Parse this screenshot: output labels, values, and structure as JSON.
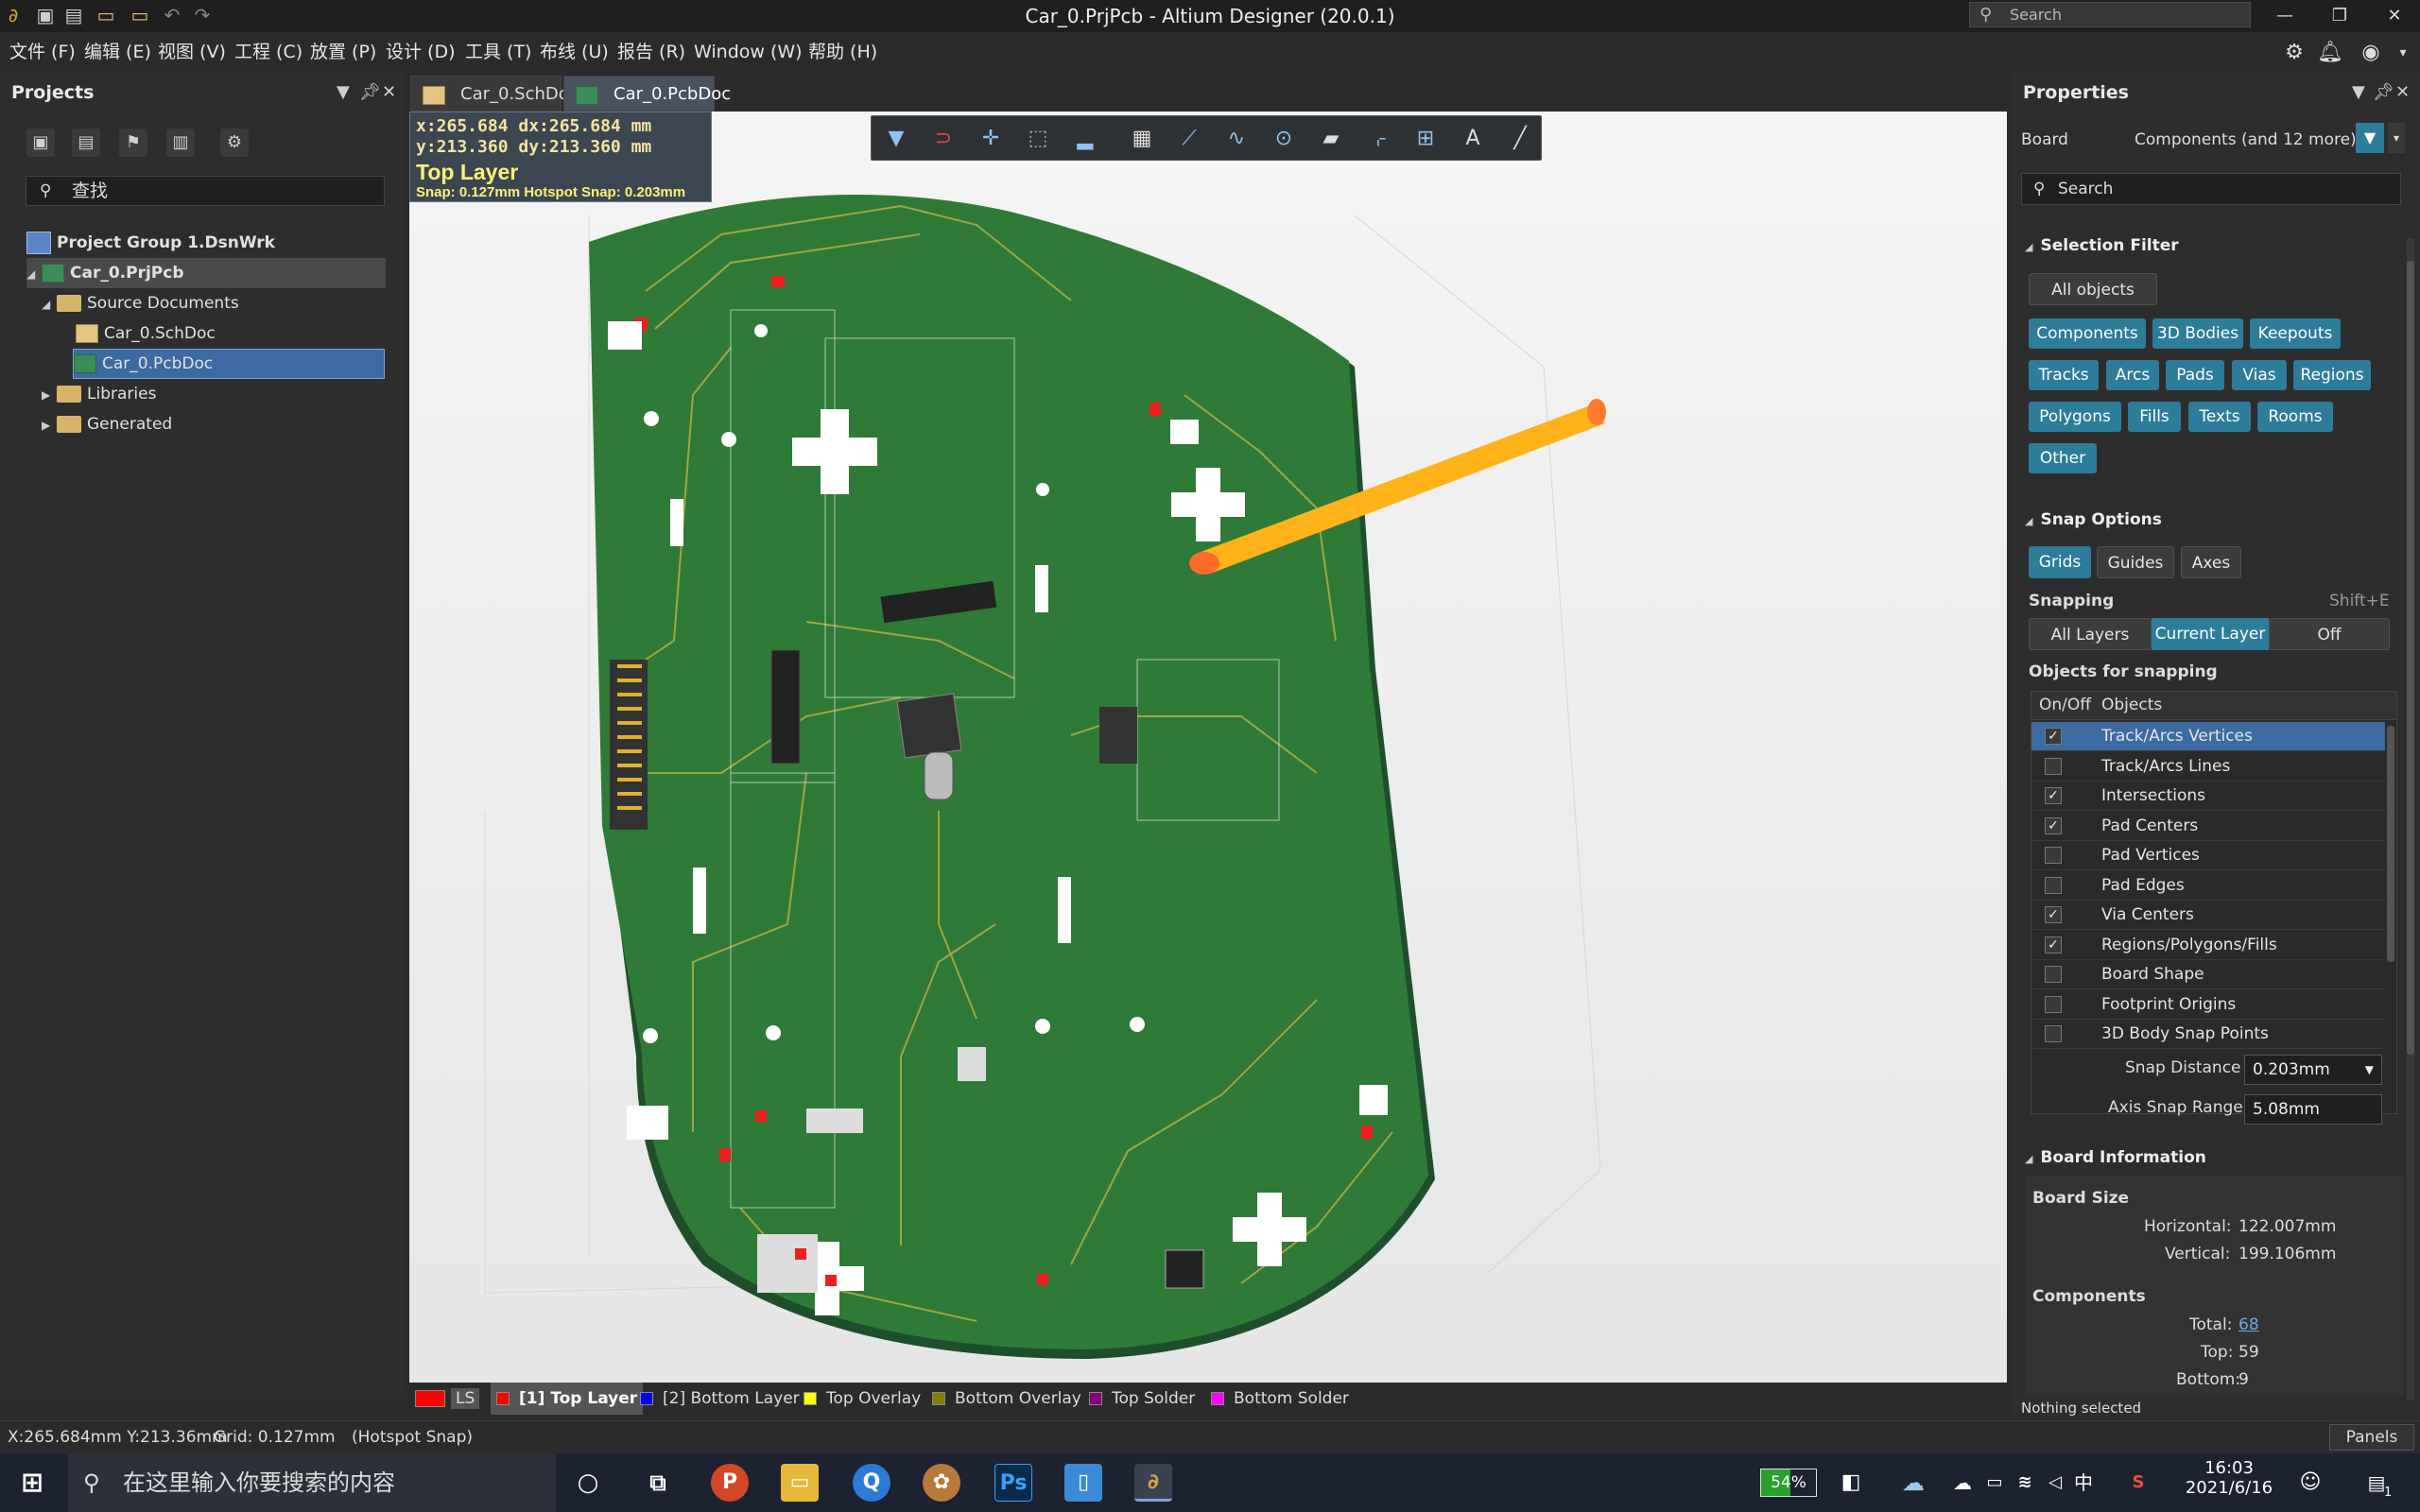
{
  "window": {
    "title": "Car_0.PrjPcb - Altium Designer (20.0.1)",
    "search_placeholder": "Search"
  },
  "menu": [
    "文件 (F)",
    "编辑 (E)",
    "视图 (V)",
    "工程 (C)",
    "放置 (P)",
    "设计 (D)",
    "工具 (T)",
    "布线 (U)",
    "报告 (R)",
    "Window (W)",
    "帮助 (H)"
  ],
  "projects_panel": {
    "title": "Projects",
    "search_placeholder": "查找",
    "tree": {
      "group": "Project Group 1.DsnWrk",
      "project": "Car_0.PrjPcb",
      "source_folder": "Source Documents",
      "sch_doc": "Car_0.SchDoc",
      "pcb_doc": "Car_0.PcbDoc",
      "libraries": "Libraries",
      "generated": "Generated"
    }
  },
  "tabs": [
    "Car_0.SchDoc",
    "Car_0.PcbDoc"
  ],
  "coords": {
    "line1": "x:265.684   dx:265.684 mm",
    "line2": "y:213.360   dy:213.360 mm",
    "layer": "Top Layer",
    "snap": "Snap: 0.127mm Hotspot Snap: 0.203mm"
  },
  "layer_tabs": {
    "ls": "LS",
    "items": [
      {
        "label": "[1] Top Layer",
        "color": "#ff0000",
        "active": true
      },
      {
        "label": "[2] Bottom Layer",
        "color": "#0000ff"
      },
      {
        "label": "Top Overlay",
        "color": "#ffff00"
      },
      {
        "label": "Bottom Overlay",
        "color": "#808000"
      },
      {
        "label": "Top Solder",
        "color": "#800080"
      },
      {
        "label": "Bottom Solder",
        "color": "#ff00ff"
      }
    ]
  },
  "properties": {
    "title": "Properties",
    "board_label": "Board",
    "filter_label": "Components (and 12 more)",
    "search_placeholder": "Search",
    "selection_filter": {
      "title": "Selection Filter",
      "all_objects": "All objects",
      "buttons": [
        "Components",
        "3D Bodies",
        "Keepouts",
        "Tracks",
        "Arcs",
        "Pads",
        "Vias",
        "Regions",
        "Polygons",
        "Fills",
        "Texts",
        "Rooms",
        "Other"
      ]
    },
    "snap_options": {
      "title": "Snap Options",
      "grids": "Grids",
      "guides": "Guides",
      "axes": "Axes",
      "snapping_label": "Snapping",
      "snapping_shortcut": "Shift+E",
      "all_layers": "All Layers",
      "current_layer": "Current Layer",
      "off": "Off",
      "objects_title": "Objects for snapping",
      "col_onoff": "On/Off",
      "col_objects": "Objects",
      "objects": [
        {
          "name": "Track/Arcs Vertices",
          "on": true
        },
        {
          "name": "Track/Arcs Lines",
          "on": false
        },
        {
          "name": "Intersections",
          "on": true
        },
        {
          "name": "Pad Centers",
          "on": true
        },
        {
          "name": "Pad Vertices",
          "on": false
        },
        {
          "name": "Pad Edges",
          "on": false
        },
        {
          "name": "Via Centers",
          "on": true
        },
        {
          "name": "Regions/Polygons/Fills",
          "on": true
        },
        {
          "name": "Board Shape",
          "on": false
        },
        {
          "name": "Footprint Origins",
          "on": false
        },
        {
          "name": "3D Body Snap Points",
          "on": false
        }
      ],
      "snap_distance_label": "Snap Distance",
      "snap_distance": "0.203mm",
      "axis_snap_label": "Axis Snap Range",
      "axis_snap": "5.08mm"
    },
    "board_info": {
      "title": "Board Information",
      "board_size": "Board Size",
      "horizontal_label": "Horizontal:",
      "horizontal": "122.007mm",
      "vertical_label": "Vertical:",
      "vertical": "199.106mm",
      "components": "Components",
      "total_label": "Total:",
      "total": "68",
      "top_label": "Top:",
      "top": "59",
      "bottom_label": "Bottom:",
      "bottom": "9"
    },
    "status": "Nothing selected"
  },
  "status_bar": {
    "coords": "X:265.684mm Y:213.36mm",
    "grid": "Grid: 0.127mm",
    "snap": "(Hotspot Snap)",
    "panels": "Panels"
  },
  "taskbar": {
    "search_placeholder": "在这里输入你要搜索的内容",
    "battery": "54%",
    "time": "16:03",
    "date": "2021/6/16",
    "ime": "中",
    "notif_count": "1"
  }
}
